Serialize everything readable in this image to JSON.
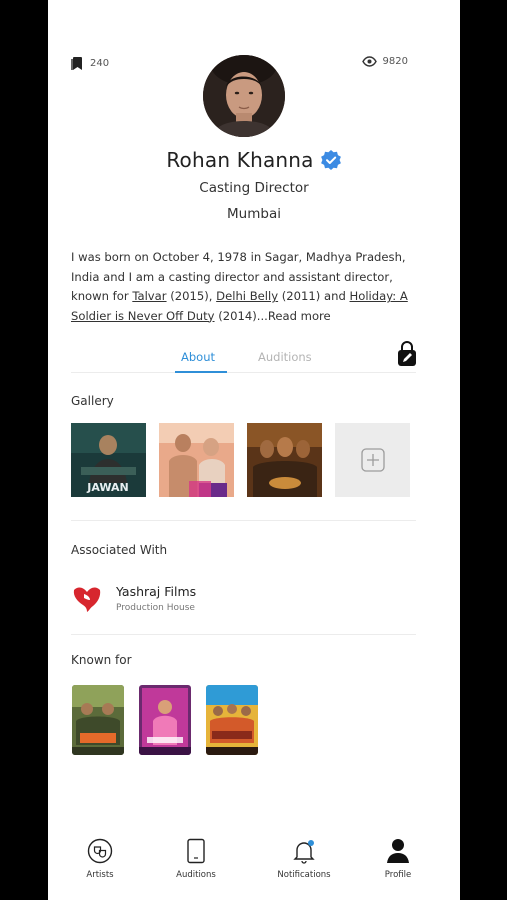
{
  "stats": {
    "bookmarks": "240",
    "views": "9820"
  },
  "profile": {
    "name": "Rohan Khanna",
    "role": "Casting Director",
    "city": "Mumbai"
  },
  "bio": {
    "text_1": "I was born on October 4, 1978 in Sagar, Madhya Pradesh, India and I am a casting director and assistant director, known for ",
    "link_1": "Talvar",
    "text_2": " (2015), ",
    "link_2": "Delhi Belly",
    "text_3": " (2011) and ",
    "link_3": "Holiday: A Soldier is Never Off Duty",
    "text_4": " (2014)...",
    "read_more": "Read more"
  },
  "tabs": {
    "about": "About",
    "auditions": "Auditions"
  },
  "gallery": {
    "title": "Gallery",
    "items": [
      {
        "name": "JAWAN"
      },
      {
        "name": "dance-poster"
      },
      {
        "name": "period-poster"
      }
    ]
  },
  "associated": {
    "title": "Associated With",
    "company": "Yashraj Films",
    "type": "Production House",
    "logo_color": "#d7262e"
  },
  "known_for": {
    "title": "Known for"
  },
  "bottom_nav": {
    "artists": "Artists",
    "auditions": "Auditions",
    "notifications": "Notifications",
    "profile": "Profile"
  },
  "colors": {
    "accent": "#2f8fd8",
    "verified": "#3c8be3"
  }
}
